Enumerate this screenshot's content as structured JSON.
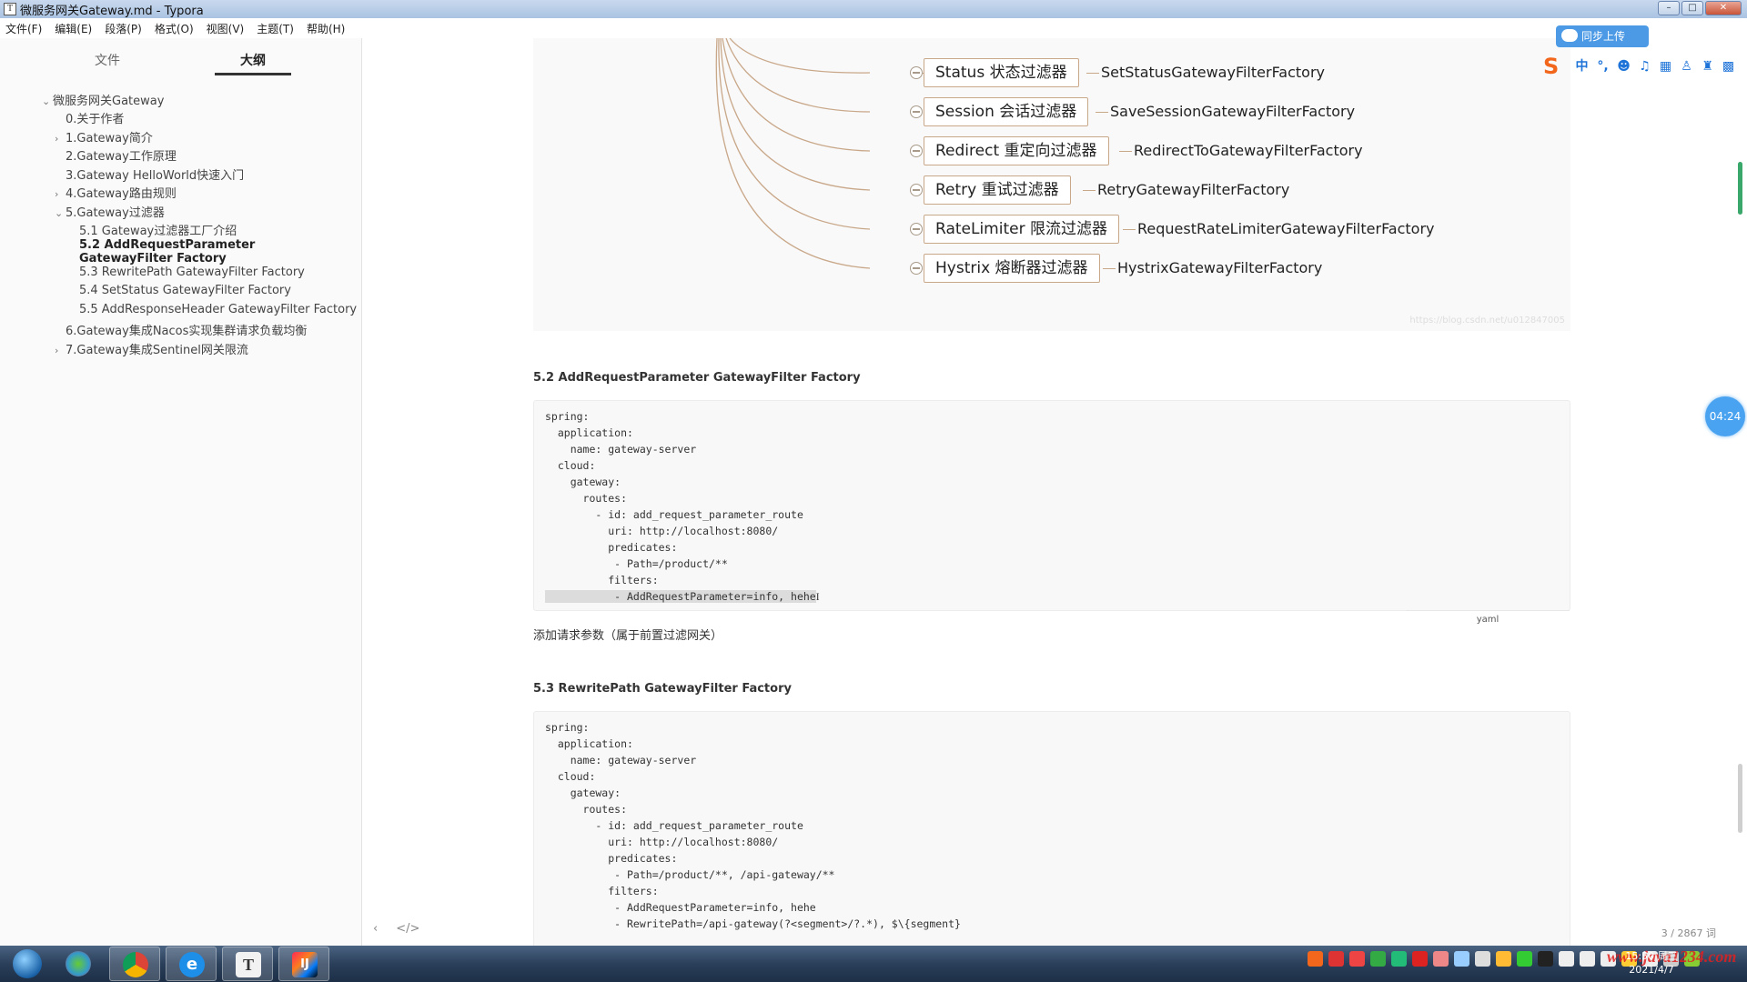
{
  "window": {
    "title": "微服务网关Gateway.md - Typora",
    "app_icon": "T"
  },
  "menu": [
    "文件(F)",
    "编辑(E)",
    "段落(P)",
    "格式(O)",
    "视图(V)",
    "主题(T)",
    "帮助(H)"
  ],
  "sidebar": {
    "tabs": [
      "文件",
      "大纲"
    ],
    "active_tab": "大纲",
    "outline": [
      {
        "label": "微服务网关Gateway",
        "arrow": "⌄"
      },
      {
        "label": "0.关于作者",
        "arrow": ""
      },
      {
        "label": "1.Gateway简介",
        "arrow": "›"
      },
      {
        "label": "2.Gateway工作原理",
        "arrow": ""
      },
      {
        "label": "3.Gateway HelloWorld快速入门",
        "arrow": ""
      },
      {
        "label": "4.Gateway路由规则",
        "arrow": "›"
      },
      {
        "label": "5.Gateway过滤器",
        "arrow": "⌄"
      },
      {
        "label": "5.1 Gateway过滤器工厂介绍",
        "arrow": ""
      },
      {
        "label": "5.2 AddRequestParameter GatewayFilter Factory",
        "arrow": "",
        "active": true
      },
      {
        "label": "5.3 RewritePath GatewayFilter Factory",
        "arrow": ""
      },
      {
        "label": "5.4 SetStatus GatewayFilter Factory",
        "arrow": ""
      },
      {
        "label": "5.5 AddResponseHeader GatewayFilter Factory",
        "arrow": ""
      },
      {
        "label": "6.Gateway集成Nacos实现集群请求负载均衡",
        "arrow": ""
      },
      {
        "label": "7.Gateway集成Sentinel网关限流",
        "arrow": "›"
      }
    ]
  },
  "mindmap": {
    "nodes": [
      {
        "label": "Status 状态过滤器",
        "factory": "SetStatusGatewayFilterFactory"
      },
      {
        "label": "Session 会话过滤器",
        "factory": "SaveSessionGatewayFilterFactory"
      },
      {
        "label": "Redirect 重定向过滤器",
        "factory": "RedirectToGatewayFilterFactory"
      },
      {
        "label": "Retry 重试过滤器",
        "factory": "RetryGatewayFilterFactory"
      },
      {
        "label": "RateLimiter 限流过滤器",
        "factory": "RequestRateLimiterGatewayFilterFactory"
      },
      {
        "label": "Hystrix 熔断器过滤器",
        "factory": "HystrixGatewayFilterFactory"
      }
    ],
    "watermark": "https://blog.csdn.net/u012847005"
  },
  "section52": {
    "heading": "5.2  AddRequestParameter GatewayFilter Factory",
    "code_lines": [
      "spring:",
      "  application:",
      "    name: gateway-server",
      "  cloud:",
      "    gateway:",
      "      routes:",
      "        - id: add_request_parameter_route",
      "          uri: http://localhost:8080/",
      "          predicates:",
      "           - Path=/product/**",
      "          filters:"
    ],
    "code_highlight_line": "           - AddRequestParameter=info, hehe",
    "lang": "yaml",
    "paragraph": "添加请求参数（属于前置过滤网关）"
  },
  "section53": {
    "heading": "5.3  RewritePath GatewayFilter Factory",
    "code": "spring:\n  application:\n    name: gateway-server\n  cloud:\n    gateway:\n      routes:\n        - id: add_request_parameter_route\n          uri: http://localhost:8080/\n          predicates:\n           - Path=/product/**, /api-gateway/**\n          filters:\n           - AddRequestParameter=info, hehe\n           - RewritePath=/api-gateway(?<segment>/?.*), $\\{segment}"
  },
  "footer": {
    "back": "‹",
    "source": "</>",
    "wordcount": "3 / 2867 词"
  },
  "timer": "04:24",
  "ime": {
    "cloud_label": "同步上传",
    "mode": "中"
  },
  "taskbar": {
    "clock_time": "15:50 周三",
    "clock_date": "2021/4/7",
    "watermark": "www.java1234.com",
    "apps": [
      "chrome",
      "qq-browser",
      "typora",
      "intellij"
    ]
  },
  "colors": {
    "accent": "#4aa3f0",
    "mindmap_border": "#c9a88a",
    "taskbar": "#2a3f5a"
  }
}
